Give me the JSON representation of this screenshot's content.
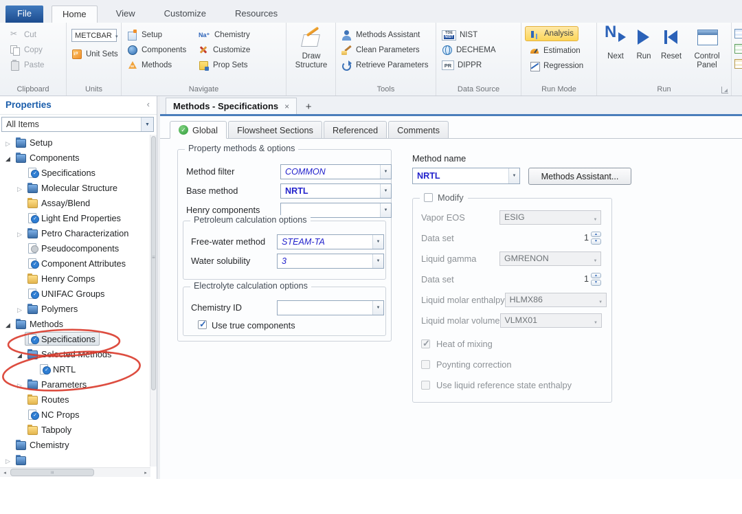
{
  "ribbon": {
    "tabs": [
      {
        "label": "File",
        "file": true
      },
      {
        "label": "Home",
        "active": true
      },
      {
        "label": "View"
      },
      {
        "label": "Customize"
      },
      {
        "label": "Resources"
      }
    ],
    "clipboard": {
      "group_label": "Clipboard",
      "cut": "Cut",
      "copy": "Copy",
      "paste": "Paste"
    },
    "units": {
      "group_label": "Units",
      "unit_set_value": "METCBAR",
      "unit_sets": "Unit Sets"
    },
    "navigate": {
      "group_label": "Navigate",
      "setup": "Setup",
      "components": "Components",
      "methods": "Methods",
      "chemistry": "Chemistry",
      "chemistry_icon_text": "Na⁺",
      "customize": "Customize",
      "prop_sets": "Prop Sets"
    },
    "draw_structure": {
      "line1": "Draw",
      "line2": "Structure"
    },
    "tools": {
      "group_label": "Tools",
      "methods_assistant": "Methods Assistant",
      "clean_parameters": "Clean Parameters",
      "retrieve_parameters": "Retrieve Parameters"
    },
    "data_source": {
      "group_label": "Data Source",
      "nist": "NIST",
      "nist_icon_top": "TDE",
      "nist_icon_bottom": "NIST",
      "dechema": "DECHEMA",
      "dippr": "DIPPR",
      "dippr_icon_text": "PR"
    },
    "run_mode": {
      "group_label": "Run Mode",
      "analysis": "Analysis",
      "estimation": "Estimation",
      "regression": "Regression"
    },
    "run": {
      "group_label": "Run",
      "next": "Next",
      "run": "Run",
      "reset": "Reset",
      "control_panel": "Control Panel"
    }
  },
  "properties_panel": {
    "title": "Properties",
    "filter_value": "All Items",
    "tree": [
      {
        "label": "Setup",
        "level": 0,
        "expander": "collapsed",
        "icon": "folder"
      },
      {
        "label": "Components",
        "level": 0,
        "expander": "expanded",
        "icon": "folder"
      },
      {
        "label": "Specifications",
        "level": 1,
        "icon": "form-check"
      },
      {
        "label": "Molecular Structure",
        "level": 1,
        "expander": "collapsed",
        "icon": "folder"
      },
      {
        "label": "Assay/Blend",
        "level": 1,
        "icon": "folder-plain"
      },
      {
        "label": "Light End Properties",
        "level": 1,
        "icon": "form-check"
      },
      {
        "label": "Petro Characterization",
        "level": 1,
        "expander": "collapsed",
        "icon": "folder"
      },
      {
        "label": "Pseudocomponents",
        "level": 1,
        "icon": "form-plain"
      },
      {
        "label": "Component Attributes",
        "level": 1,
        "icon": "form-check"
      },
      {
        "label": "Henry Comps",
        "level": 1,
        "icon": "folder-plain"
      },
      {
        "label": "UNIFAC Groups",
        "level": 1,
        "icon": "form-check"
      },
      {
        "label": "Polymers",
        "level": 1,
        "expander": "collapsed",
        "icon": "folder"
      },
      {
        "label": "Methods",
        "level": 0,
        "expander": "expanded",
        "icon": "folder"
      },
      {
        "label": "Specifications",
        "level": 1,
        "icon": "form-check",
        "selected": true
      },
      {
        "label": "Selected Methods",
        "level": 1,
        "expander": "expanded",
        "icon": "folder"
      },
      {
        "label": "NRTL",
        "level": 2,
        "icon": "form-check"
      },
      {
        "label": "Parameters",
        "level": 1,
        "expander": "collapsed",
        "icon": "folder"
      },
      {
        "label": "Routes",
        "level": 1,
        "icon": "folder-plain"
      },
      {
        "label": "NC Props",
        "level": 1,
        "icon": "form-check"
      },
      {
        "label": "Tabpoly",
        "level": 1,
        "icon": "folder-plain"
      },
      {
        "label": "Chemistry",
        "level": 0,
        "icon": "folder"
      },
      {
        "label": "",
        "level": 0,
        "expander": "collapsed",
        "icon": "folder",
        "partial": true
      }
    ]
  },
  "document_tabs": {
    "active_tab": "Methods - Specifications"
  },
  "form_tabs": [
    {
      "label": "Global",
      "active": true,
      "icon": "check"
    },
    {
      "label": "Flowsheet Sections"
    },
    {
      "label": "Referenced"
    },
    {
      "label": "Comments"
    }
  ],
  "global_form": {
    "property_group": {
      "title": "Property methods & options",
      "method_filter_label": "Method filter",
      "method_filter_value": "COMMON",
      "base_method_label": "Base method",
      "base_method_value": "NRTL",
      "henry_label": "Henry components",
      "henry_value": "",
      "petroleum": {
        "title": "Petroleum calculation options",
        "free_water_label": "Free-water method",
        "free_water_value": "STEAM-TA",
        "water_solubility_label": "Water solubility",
        "water_solubility_value": "3"
      },
      "electrolyte": {
        "title": "Electrolyte calculation options",
        "chemistry_id_label": "Chemistry ID",
        "chemistry_id_value": "",
        "use_true_components_label": "Use true components"
      }
    },
    "method_name": {
      "label": "Method name",
      "value": "NRTL",
      "assistant_button": "Methods Assistant..."
    },
    "modify_group": {
      "title": "Modify",
      "rows": [
        {
          "label": "Vapor EOS",
          "value": "ESIG",
          "type": "combo"
        },
        {
          "label": "Data set",
          "value": "1",
          "type": "spinner"
        },
        {
          "label": "Liquid gamma",
          "value": "GMRENON",
          "type": "combo"
        },
        {
          "label": "Data set",
          "value": "1",
          "type": "spinner"
        },
        {
          "label": "Liquid molar enthalpy",
          "value": "HLMX86",
          "type": "combo"
        },
        {
          "label": "Liquid molar volume",
          "value": "VLMX01",
          "type": "combo"
        }
      ],
      "checkboxes": [
        {
          "label": "Heat of mixing",
          "checked": true,
          "disabled": true
        },
        {
          "label": "Poynting correction",
          "disabled": true
        },
        {
          "label": "Use liquid reference state enthalpy",
          "disabled": true
        }
      ]
    }
  },
  "annotations": {
    "pen_color": "#d93a2b"
  }
}
